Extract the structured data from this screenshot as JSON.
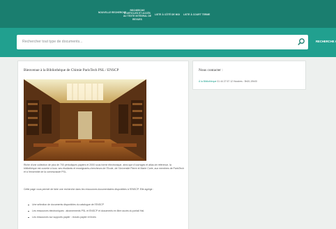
{
  "nav": {
    "items": [
      {
        "label": "NOUVELLE RECHERCHE"
      },
      {
        "label": "RECHERCHE D'ARTICLES ET ACCÈS AU TEXTE INTÉGRAL DE REVUES"
      },
      {
        "label": "LISTE À CÔTÉ DE MOI"
      },
      {
        "label": "LISTE À COURT TERME"
      }
    ]
  },
  "search": {
    "placeholder": "Rechercher tout type de documents...",
    "submit_label": "RECHERCHE AVANCÉE"
  },
  "main_card": {
    "title": "Bienvenue à la Bibliothèque de Chimie ParisTech PSL / ENSCP",
    "image_alt": "Salle de lecture de la bibliothèque",
    "paragraph1": "Riche d'une collection de plus de 700 périodiques papiers et 2000 sous forme électronique, ainsi que d'ouvrages et atlas de référence, la bibliothèque est ouverte à tous: ses étudiants et enseignants-chercheurs de l'Ecole, de l'Université Pierre et Marie Curie, aux membres de ParisTech et à l'ensemble de la communauté PSL.",
    "paragraph2": "Cette page vous permet de faire une recherche dans les ressources documentaires disponibles à l'ENSCP. Elle agrège :",
    "bullets": [
      "Une sélection de documents disponibles du catalogue de l'ENSCP",
      "Les ressources électroniques : abonnements PSL et ENSCP et documents en libre accès du portail Hal.",
      "Les ressources sur supports papier : revues papier et livres"
    ]
  },
  "side_card": {
    "title": "Nous contacter :",
    "link_label": "À la Bibliothèque",
    "contact_text": "01 44 27 67 12 Horaires : 9h00-19h00"
  },
  "colors": {
    "nav_bg": "#1a7e6f",
    "search_bg": "#21a08f",
    "link": "#1a9f8c",
    "page_bg": "#edf0ee"
  }
}
